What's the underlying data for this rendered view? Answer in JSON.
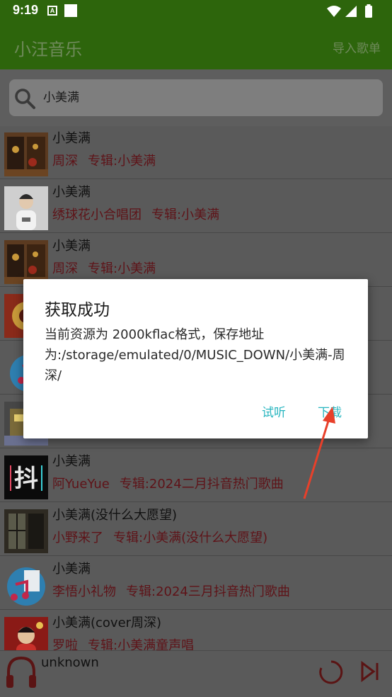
{
  "status_bar": {
    "time": "9:19",
    "a_icon": "A"
  },
  "app_bar": {
    "title": "小汪音乐",
    "import_label": "导入歌单"
  },
  "search": {
    "value": "小美满"
  },
  "songs": [
    {
      "title": "小美满",
      "artist": "周深",
      "album": "专辑:小美满"
    },
    {
      "title": "小美满",
      "artist": "绣球花小合唱团",
      "album": "专辑:小美满"
    },
    {
      "title": "小美满",
      "artist": "周深",
      "album": "专辑:小美满"
    },
    {
      "title": "小美满",
      "artist": "阿YueYue",
      "album": "专辑:2024二月抖音热门歌曲"
    },
    {
      "title": "小美满(没什么大愿望)",
      "artist": "小野来了",
      "album": "专辑:小美满(没什么大愿望)"
    },
    {
      "title": "小美满",
      "artist": "李悟小礼物",
      "album": "专辑:2024三月抖音热门歌曲"
    },
    {
      "title": "小美满(cover周深)",
      "artist": "罗啦",
      "album": "专辑:小美满童声唱"
    }
  ],
  "player": {
    "track": "unknown"
  },
  "dialog": {
    "title": "获取成功",
    "message": "当前资源为 2000kflac格式，保存地址为:/storage/emulated/0/MUSIC_DOWN/小美满-周深/",
    "listen_label": "试听",
    "download_label": "下载"
  },
  "colors": {
    "app_bar": "#2d650c",
    "accent": "#27b5bf",
    "subtitle": "#5e1318",
    "annotation_arrow": "#e8402a"
  }
}
